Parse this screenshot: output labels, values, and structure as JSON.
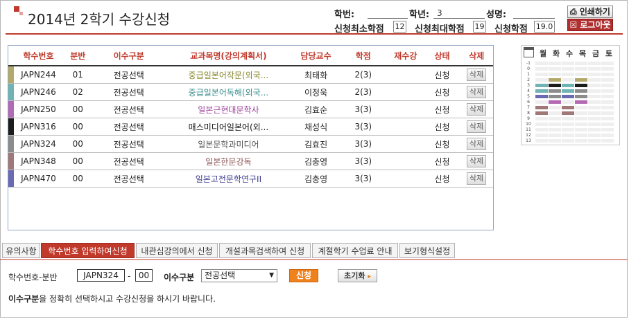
{
  "header": {
    "title": "2014년 2학기 수강신청",
    "hakbun_label": "학번:",
    "hakbun_value": "",
    "hangnyun_label": "학년:",
    "hangnyun_value": "3",
    "name_label": "성명:",
    "name_value": "",
    "min_credit_label": "신청최소학점",
    "min_credit_value": "12",
    "max_credit_label": "신청최대학점",
    "max_credit_value": "19",
    "applied_credit_label": "신청학점",
    "applied_credit_value": "19.0",
    "print_label": "인쇄하기",
    "logout_label": "로그아웃"
  },
  "table": {
    "columns": [
      "학수번호",
      "분반",
      "이수구분",
      "교과목명(강의계획서)",
      "담당교수",
      "학점",
      "재수강",
      "상태",
      "삭제"
    ],
    "rows": [
      {
        "code": "JAPN244",
        "section": "01",
        "type": "전공선택",
        "name": "중급일본어작문(외국...",
        "prof": "최태화",
        "credit": "2(3)",
        "retake": "",
        "status": "신청",
        "del": "삭제",
        "color": "#b3a96a",
        "name_color": "#8a8a32"
      },
      {
        "code": "JAPN246",
        "section": "02",
        "type": "전공선택",
        "name": "중급일본어독해(외국...",
        "prof": "이정욱",
        "credit": "2(3)",
        "retake": "",
        "status": "신청",
        "del": "삭제",
        "color": "#6fb3b3",
        "name_color": "#3d8f8f"
      },
      {
        "code": "JAPN250",
        "section": "00",
        "type": "전공선택",
        "name": "일본근현대문학사",
        "prof": "김효순",
        "credit": "3(3)",
        "retake": "",
        "status": "신청",
        "del": "삭제",
        "color": "#b36ab3",
        "name_color": "#9b3d9b"
      },
      {
        "code": "JAPN316",
        "section": "00",
        "type": "전공선택",
        "name": "매스미디어일본어(외...",
        "prof": "채성식",
        "credit": "3(3)",
        "retake": "",
        "status": "신청",
        "del": "삭제",
        "color": "#1c1c1c",
        "name_color": "#111111"
      },
      {
        "code": "JAPN324",
        "section": "00",
        "type": "전공선택",
        "name": "일본문학과미디어",
        "prof": "김효진",
        "credit": "3(3)",
        "retake": "",
        "status": "신청",
        "del": "삭제",
        "color": "#8c8c8c",
        "name_color": "#555555"
      },
      {
        "code": "JAPN348",
        "section": "00",
        "type": "전공선택",
        "name": "일본한문강독",
        "prof": "김충영",
        "credit": "3(3)",
        "retake": "",
        "status": "신청",
        "del": "삭제",
        "color": "#a07878",
        "name_color": "#8a5050"
      },
      {
        "code": "JAPN470",
        "section": "00",
        "type": "전공선택",
        "name": "일본고전문학연구II",
        "prof": "김충영",
        "credit": "3(3)",
        "retake": "",
        "status": "신청",
        "del": "삭제",
        "color": "#6a6ab3",
        "name_color": "#3d3d8f"
      }
    ]
  },
  "timetable": {
    "days": [
      "월",
      "화",
      "수",
      "목",
      "금",
      "토"
    ],
    "periods": [
      "-1",
      "0",
      "1",
      "2",
      "3",
      "4",
      "5",
      "6",
      "7",
      "8",
      "9",
      "10",
      "11",
      "12",
      "13"
    ],
    "filled": [
      {
        "period": "2",
        "day": 1,
        "color": "#b3a96a"
      },
      {
        "period": "2",
        "day": 3,
        "color": "#b3a96a"
      },
      {
        "period": "3",
        "day": 0,
        "color": "#6fb3b3"
      },
      {
        "period": "3",
        "day": 1,
        "color": "#1c1c1c"
      },
      {
        "period": "3",
        "day": 2,
        "color": "#6fb3b3"
      },
      {
        "period": "3",
        "day": 3,
        "color": "#1c1c1c"
      },
      {
        "period": "4",
        "day": 0,
        "color": "#6fb3b3"
      },
      {
        "period": "4",
        "day": 1,
        "color": "#8c8c8c"
      },
      {
        "period": "4",
        "day": 2,
        "color": "#6fb3b3"
      },
      {
        "period": "4",
        "day": 3,
        "color": "#8c8c8c"
      },
      {
        "period": "5",
        "day": 0,
        "color": "#6a6ab3"
      },
      {
        "period": "5",
        "day": 1,
        "color": "#8c8c8c"
      },
      {
        "period": "5",
        "day": 2,
        "color": "#6a6ab3"
      },
      {
        "period": "5",
        "day": 3,
        "color": "#8c8c8c"
      },
      {
        "period": "6",
        "day": 1,
        "color": "#b36ab3"
      },
      {
        "period": "6",
        "day": 3,
        "color": "#b36ab3"
      },
      {
        "period": "7",
        "day": 0,
        "color": "#a07878"
      },
      {
        "period": "7",
        "day": 2,
        "color": "#a07878"
      },
      {
        "period": "8",
        "day": 0,
        "color": "#a07878"
      },
      {
        "period": "8",
        "day": 2,
        "color": "#a07878"
      }
    ]
  },
  "tabs": [
    {
      "label": "유의사항",
      "active": false
    },
    {
      "label": "학수번호 입력하여신청",
      "active": true
    },
    {
      "label": "내관심강의에서 신청",
      "active": false
    },
    {
      "label": "개설과목검색하여 신청",
      "active": false
    },
    {
      "label": "계절학기 수업료 안내",
      "active": false
    },
    {
      "label": "보기형식설정",
      "active": false
    }
  ],
  "form": {
    "code_label": "학수번호-분반",
    "code_value": "JAPN324",
    "dash": "-",
    "section_value": "00",
    "type_label": "이수구분",
    "type_value": "전공선택",
    "apply_label": "신청",
    "reset_label": "초기화",
    "notice_bold": "이수구분",
    "notice_rest": "을 정확히 선택하시고 수강신청을 하시기 바랍니다."
  }
}
